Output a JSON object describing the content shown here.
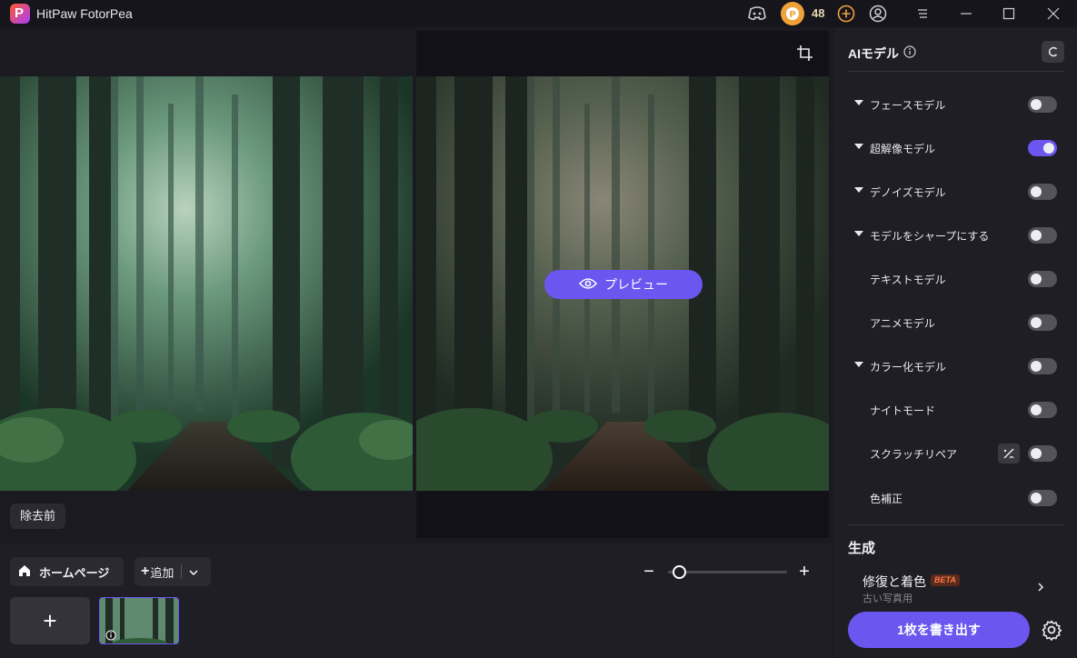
{
  "app": {
    "title": "HitPaw FotorPea",
    "credits": "48"
  },
  "canvas": {
    "preview_label": "プレビュー",
    "before_label": "除去前"
  },
  "bottom": {
    "home_label": "ホームページ",
    "add_label": "追加",
    "zoom_level": 0.05
  },
  "panel": {
    "title": "AIモデル",
    "models": [
      {
        "label": "フェースモデル",
        "expandable": true,
        "enabled": false
      },
      {
        "label": "超解像モデル",
        "expandable": true,
        "enabled": true
      },
      {
        "label": "デノイズモデル",
        "expandable": true,
        "enabled": false
      },
      {
        "label": "モデルをシャープにする",
        "expandable": true,
        "enabled": false
      },
      {
        "label": "テキストモデル",
        "expandable": false,
        "enabled": false
      },
      {
        "label": "アニメモデル",
        "expandable": false,
        "enabled": false
      },
      {
        "label": "カラー化モデル",
        "expandable": true,
        "enabled": false
      },
      {
        "label": "ナイトモード",
        "expandable": false,
        "enabled": false
      },
      {
        "label": "スクラッチリペア",
        "expandable": false,
        "enabled": false
      },
      {
        "label": "色補正",
        "expandable": false,
        "enabled": false
      }
    ],
    "generate": {
      "title": "生成",
      "item_title": "修復と着色",
      "badge": "BETA",
      "item_subtitle": "古い写真用"
    },
    "export_label": "1枚を書き出す"
  },
  "colors": {
    "accent": "#6b56f0",
    "panel": "#1f1e25",
    "badge": "#ff7a4a"
  }
}
